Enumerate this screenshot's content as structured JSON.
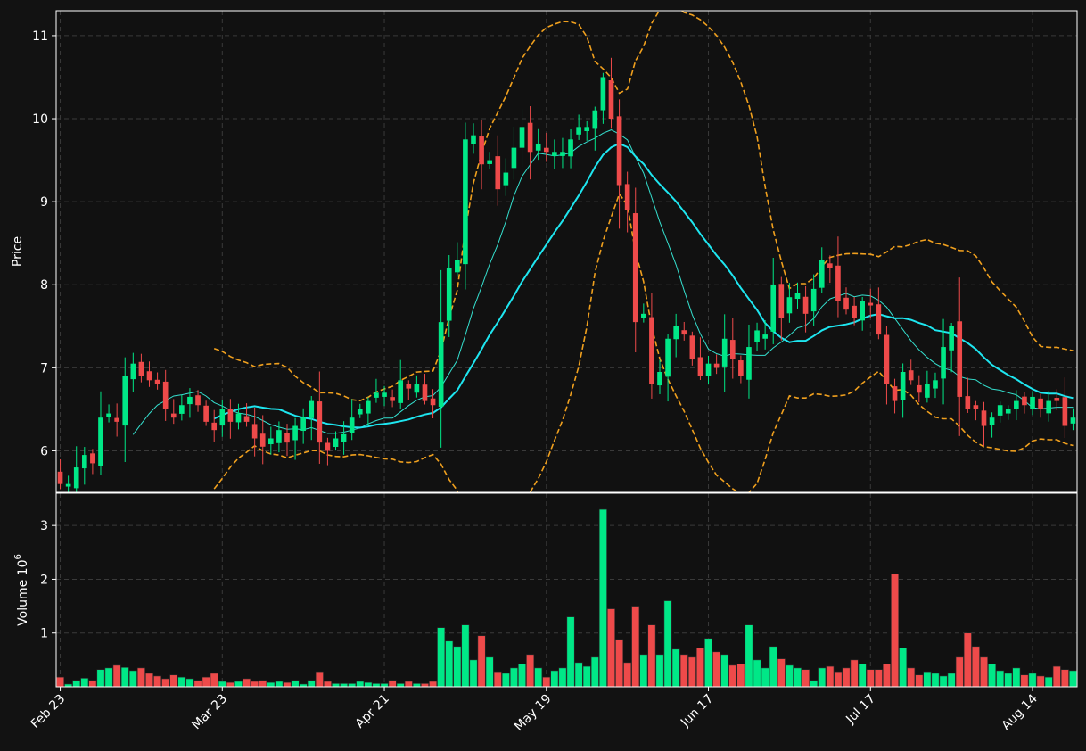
{
  "colors": {
    "background": "#121212",
    "panel": "#111111",
    "grid": "#3a3a3a",
    "axis": "#ffffff",
    "up": "#00e887",
    "down": "#ee4a4a",
    "ma_fast": "#35e0cf",
    "ma_slow": "#1ee6f0",
    "bollinger": "#f0a01e"
  },
  "chart_data": [
    {
      "type": "candlestick",
      "panel": "price",
      "ylabel": "Price",
      "ylim": [
        5.5,
        11.3
      ],
      "yticks": [
        6,
        7,
        8,
        9,
        10,
        11
      ],
      "grid": true,
      "x_tick_labels": [
        {
          "label": "Feb 23",
          "index": 0
        },
        {
          "label": "Mar 23",
          "index": 20
        },
        {
          "label": "Apr 21",
          "index": 40
        },
        {
          "label": "May 19",
          "index": 60
        },
        {
          "label": "Jun 17",
          "index": 80
        },
        {
          "label": "Jul 17",
          "index": 100
        },
        {
          "label": "Aug 14",
          "index": 120
        }
      ],
      "n_sessions": 126,
      "close_anchors": [
        [
          0,
          5.6
        ],
        [
          1,
          5.6
        ],
        [
          2,
          5.8
        ],
        [
          3,
          5.95
        ],
        [
          4,
          5.85
        ],
        [
          5,
          6.4
        ],
        [
          6,
          6.45
        ],
        [
          7,
          6.35
        ],
        [
          8,
          6.9
        ],
        [
          9,
          7.05
        ],
        [
          10,
          6.9
        ],
        [
          11,
          6.85
        ],
        [
          12,
          6.8
        ],
        [
          13,
          6.5
        ],
        [
          14,
          6.4
        ],
        [
          15,
          6.55
        ],
        [
          16,
          6.65
        ],
        [
          17,
          6.55
        ],
        [
          18,
          6.35
        ],
        [
          19,
          6.25
        ],
        [
          20,
          6.5
        ],
        [
          21,
          6.35
        ],
        [
          22,
          6.45
        ],
        [
          23,
          6.35
        ],
        [
          24,
          6.15
        ],
        [
          25,
          6.05
        ],
        [
          26,
          6.15
        ],
        [
          27,
          6.25
        ],
        [
          28,
          6.1
        ],
        [
          29,
          6.3
        ],
        [
          30,
          6.4
        ],
        [
          31,
          6.6
        ],
        [
          32,
          6.1
        ],
        [
          33,
          6.0
        ],
        [
          34,
          6.15
        ],
        [
          35,
          6.2
        ],
        [
          36,
          6.4
        ],
        [
          37,
          6.5
        ],
        [
          38,
          6.6
        ],
        [
          39,
          6.7
        ],
        [
          40,
          6.7
        ],
        [
          41,
          6.6
        ],
        [
          42,
          6.85
        ],
        [
          43,
          6.75
        ],
        [
          44,
          6.8
        ],
        [
          45,
          6.6
        ],
        [
          46,
          6.55
        ],
        [
          47,
          7.55
        ],
        [
          48,
          8.2
        ],
        [
          49,
          8.3
        ],
        [
          50,
          9.75
        ],
        [
          51,
          9.8
        ],
        [
          52,
          9.45
        ],
        [
          53,
          9.5
        ],
        [
          54,
          9.15
        ],
        [
          55,
          9.35
        ],
        [
          56,
          9.65
        ],
        [
          57,
          9.9
        ],
        [
          58,
          9.6
        ],
        [
          59,
          9.7
        ],
        [
          60,
          9.6
        ],
        [
          61,
          9.6
        ],
        [
          62,
          9.6
        ],
        [
          63,
          9.75
        ],
        [
          64,
          9.9
        ],
        [
          65,
          9.9
        ],
        [
          66,
          10.1
        ],
        [
          67,
          10.5
        ],
        [
          68,
          10.0
        ],
        [
          69,
          9.2
        ],
        [
          70,
          8.9
        ],
        [
          71,
          7.55
        ],
        [
          72,
          7.65
        ],
        [
          73,
          6.8
        ],
        [
          74,
          6.95
        ],
        [
          75,
          7.35
        ],
        [
          76,
          7.5
        ],
        [
          77,
          7.4
        ],
        [
          78,
          7.1
        ],
        [
          79,
          6.9
        ],
        [
          80,
          7.05
        ],
        [
          81,
          7.0
        ],
        [
          82,
          7.35
        ],
        [
          83,
          7.1
        ],
        [
          84,
          6.9
        ],
        [
          85,
          7.25
        ],
        [
          86,
          7.45
        ],
        [
          87,
          7.4
        ],
        [
          88,
          8.0
        ],
        [
          89,
          7.6
        ],
        [
          90,
          7.85
        ],
        [
          91,
          7.9
        ],
        [
          92,
          7.65
        ],
        [
          93,
          7.95
        ],
        [
          94,
          8.3
        ],
        [
          95,
          8.2
        ],
        [
          96,
          7.8
        ],
        [
          97,
          7.7
        ],
        [
          98,
          7.6
        ],
        [
          99,
          7.8
        ],
        [
          100,
          7.75
        ],
        [
          101,
          7.4
        ],
        [
          102,
          6.8
        ],
        [
          103,
          6.6
        ],
        [
          104,
          6.95
        ],
        [
          105,
          6.85
        ],
        [
          106,
          6.7
        ],
        [
          107,
          6.8
        ],
        [
          108,
          6.85
        ],
        [
          109,
          7.25
        ],
        [
          110,
          7.5
        ],
        [
          111,
          6.65
        ],
        [
          112,
          6.5
        ],
        [
          113,
          6.5
        ],
        [
          114,
          6.3
        ],
        [
          115,
          6.4
        ],
        [
          116,
          6.55
        ],
        [
          117,
          6.5
        ],
        [
          118,
          6.6
        ],
        [
          119,
          6.55
        ],
        [
          120,
          6.65
        ],
        [
          121,
          6.5
        ],
        [
          122,
          6.6
        ],
        [
          123,
          6.6
        ],
        [
          124,
          6.3
        ],
        [
          125,
          6.4
        ]
      ],
      "ma_fast_window": 10,
      "ma_slow_window": 20,
      "bollinger_window": 20,
      "bollinger_k": 2
    },
    {
      "type": "bar",
      "panel": "volume",
      "ylabel": "Volume  10",
      "ylabel_exponent": "6",
      "ylim": [
        0,
        3.6
      ],
      "yticks": [
        1,
        2,
        3
      ],
      "grid": true,
      "units": "millions",
      "values": [
        0.18,
        0.05,
        0.12,
        0.16,
        0.12,
        0.32,
        0.35,
        0.4,
        0.36,
        0.3,
        0.35,
        0.25,
        0.2,
        0.15,
        0.22,
        0.18,
        0.15,
        0.12,
        0.18,
        0.25,
        0.1,
        0.08,
        0.1,
        0.15,
        0.1,
        0.12,
        0.08,
        0.1,
        0.08,
        0.12,
        0.05,
        0.12,
        0.28,
        0.1,
        0.06,
        0.06,
        0.06,
        0.1,
        0.08,
        0.06,
        0.06,
        0.12,
        0.06,
        0.1,
        0.06,
        0.06,
        0.1,
        1.1,
        0.85,
        0.75,
        1.15,
        0.5,
        0.95,
        0.55,
        0.28,
        0.25,
        0.35,
        0.42,
        0.6,
        0.35,
        0.18,
        0.3,
        0.35,
        1.3,
        0.45,
        0.38,
        0.55,
        3.3,
        1.45,
        0.88,
        0.45,
        1.5,
        0.6,
        1.15,
        0.6,
        1.6,
        0.7,
        0.6,
        0.55,
        0.72,
        0.9,
        0.65,
        0.6,
        0.4,
        0.42,
        1.15,
        0.5,
        0.35,
        0.75,
        0.52,
        0.4,
        0.35,
        0.32,
        0.12,
        0.35,
        0.38,
        0.28,
        0.35,
        0.5,
        0.42,
        0.32,
        0.32,
        0.42,
        2.1,
        0.72,
        0.35,
        0.22,
        0.28,
        0.25,
        0.2,
        0.25,
        0.55,
        1.0,
        0.75,
        0.55,
        0.42,
        0.3,
        0.25,
        0.35,
        0.22,
        0.25,
        0.2,
        0.18,
        0.38,
        0.32,
        0.3
      ]
    }
  ]
}
